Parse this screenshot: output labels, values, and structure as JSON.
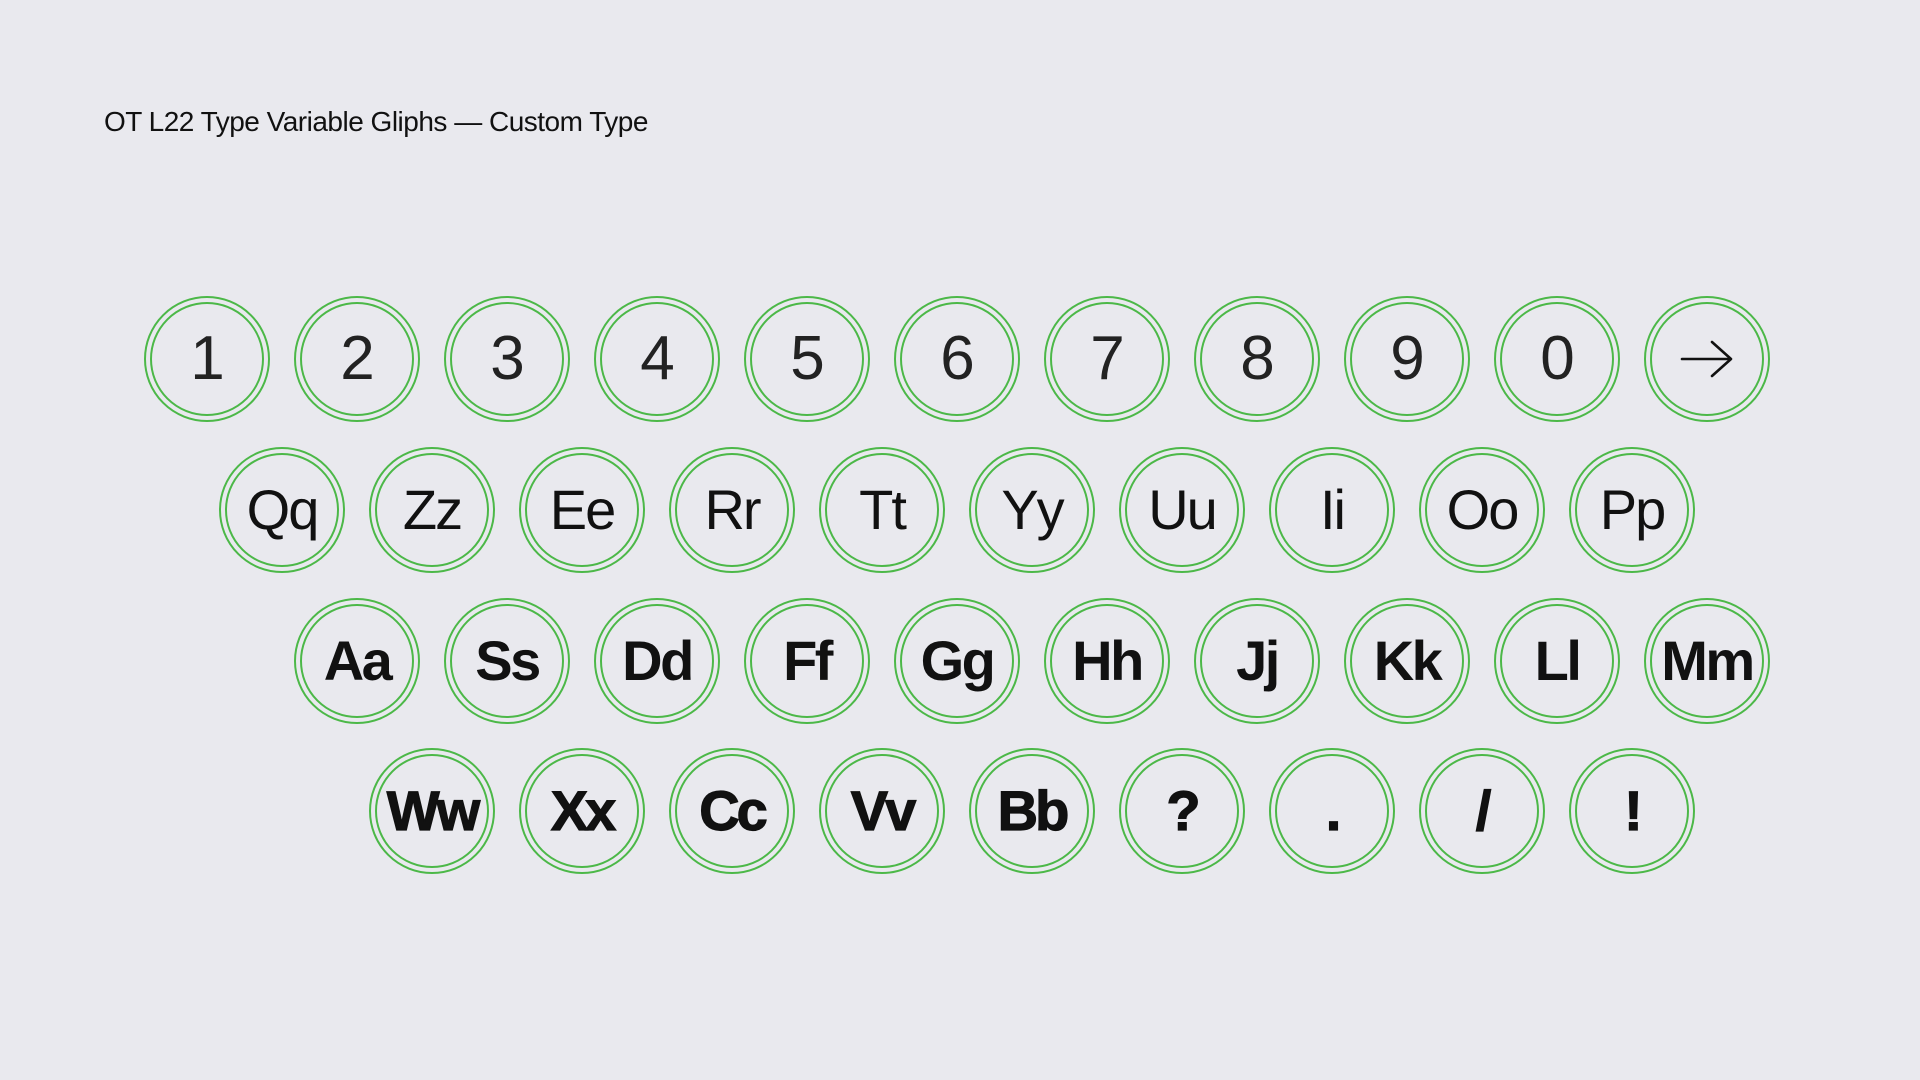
{
  "header": {
    "title": "OT L22 Type Variable Gliphs — Custom Type"
  },
  "keyboard": {
    "row1": [
      "1",
      "2",
      "3",
      "4",
      "5",
      "6",
      "7",
      "8",
      "9",
      "0",
      "→"
    ],
    "row2": [
      "Qq",
      "Zz",
      "Ee",
      "Rr",
      "Tt",
      "Yy",
      "Uu",
      "Ii",
      "Oo",
      "Pp"
    ],
    "row3": [
      "Aa",
      "Ss",
      "Dd",
      "Ff",
      "Gg",
      "Hh",
      "Jj",
      "Kk",
      "Ll",
      "Mm"
    ],
    "row4": [
      "Ww",
      "Xx",
      "Cc",
      "Vv",
      "Bb",
      "?",
      ".",
      "/",
      "!"
    ]
  },
  "colors": {
    "background": "#e9e9ee",
    "ring": "#4cb848",
    "text": "#111111"
  },
  "icons": {
    "arrow_key": "arrow-right-icon"
  }
}
